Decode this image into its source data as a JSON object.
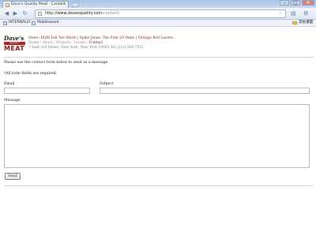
{
  "browser": {
    "tab_title": "Dave's Quality Meat - Contact",
    "tab_close": "×",
    "url_host": "http://www.davesquality.com",
    "url_path": "/contact/",
    "bookmarks": [
      {
        "label": "INTERNALLY"
      },
      {
        "label": "Mobilewood"
      }
    ],
    "other_bookmarks": "其他書籤"
  },
  "site": {
    "logo_top": "Dave's",
    "logo_band": "QUALITY",
    "logo_main": "MEAT",
    "news_label": "News:",
    "news_text": "DQM Fall Tee Shirts | Spike Jonze: The First 20 Years | Vintage Rod Lavere...",
    "nav": {
      "home": "Home",
      "about": "About",
      "projects": "Projects",
      "locate": "Locate",
      "contact": "Contact",
      "sep": " / "
    },
    "address": "7 East 3rd Street, New York, New York 10003 Tel (212) 505-7551"
  },
  "form": {
    "intro": "Please use the contact form below to send us a message.",
    "required_note": "*All form fields are required.",
    "email_label": "Email",
    "subject_label": "Subject",
    "message_label": "Message",
    "email_value": "",
    "subject_value": "",
    "message_value": "",
    "send_label": "Send"
  }
}
